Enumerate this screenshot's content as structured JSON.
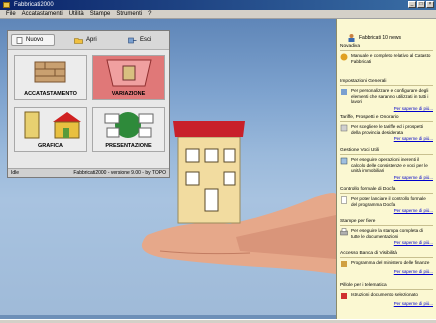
{
  "window": {
    "title": "Fabbricati2000"
  },
  "menu": [
    "File",
    "Accatastamenti",
    "Utilità",
    "Stampe",
    "Strumenti",
    "?"
  ],
  "launcher": {
    "buttons": {
      "nuovo": "Nuovo",
      "apri": "Apri",
      "esci": "Esci"
    },
    "tiles": [
      "ACCATASTAMENTO",
      "VARIAZIONE",
      "GRAFICA",
      "PRESENTAZIONE"
    ],
    "status_left": "Idle",
    "status_right": "Fabbricati2000 - versione 9.00 - by TOPO"
  },
  "side_panel": {
    "header": "Fabbricati 10 news",
    "sections": [
      {
        "title": "Novadiva",
        "text": "Manuale e completo relativo al Catasto Fabbricati",
        "more": ""
      },
      {
        "title": "Impostazioni Generali",
        "text": "Per personalizzare e configurare degli elementi che saranno utilizzati in tutti i lavori",
        "more": "Per saperne di più..."
      },
      {
        "title": "Tariffe, Prospetti e Onorario",
        "text": "Per scegliere le tariffe ed i prospetti della provincia desiderata",
        "more": "Per saperne di più..."
      },
      {
        "title": "Gestione Voci Utili",
        "text": "Per eseguire operazioni inerenti il calcolo delle consistenze e voci per le unità immobiliari",
        "more": "Per saperne di più..."
      },
      {
        "title": "Controllo formale di Docfa",
        "text": "Per poter lanciare il controllo formale del programma Docfa",
        "more": "Per saperne di più..."
      },
      {
        "title": "Stampe per fiere",
        "text": "Per eseguire la stampa completa di tutte le documentazioni",
        "more": "Per saperne di più..."
      },
      {
        "title": "Accesso Banca di Visibilità",
        "text": "Programma del ministero delle finanze",
        "more": "Per saperne di più..."
      },
      {
        "title": "Pillole per i telematica",
        "text": "Istruzioni documento selezionato",
        "more": "Per saperne di più..."
      }
    ]
  }
}
